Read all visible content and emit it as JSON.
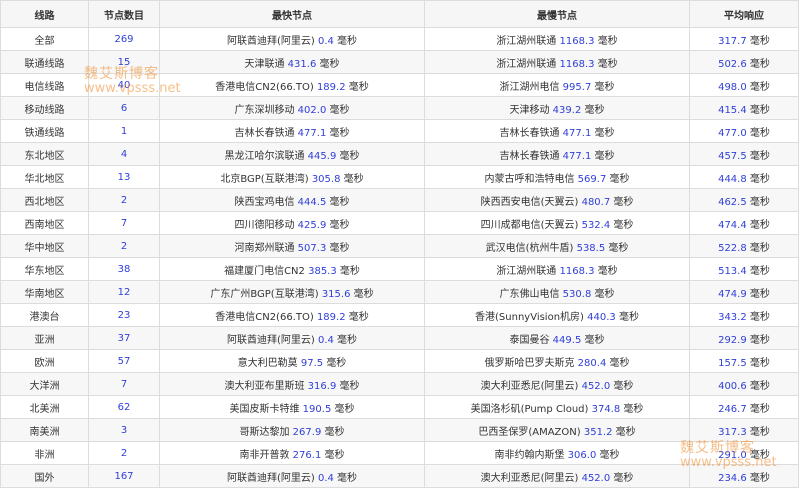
{
  "headers": {
    "route": "线路",
    "count": "节点数目",
    "fastest": "最快节点",
    "slowest": "最慢节点",
    "average": "平均响应"
  },
  "unit": "毫秒",
  "colors": {
    "number": "#2f3fd8",
    "watermark": "#f08a28"
  },
  "watermark": {
    "title": "魏艾斯博客",
    "url": "www.vpsss.net"
  },
  "rows": [
    {
      "route": "全部",
      "count": "269",
      "fast_name": "阿联酋迪拜(阿里云)",
      "fast_ms": "0.4",
      "slow_name": "浙江湖州联通",
      "slow_ms": "1168.3",
      "avg": "317.7"
    },
    {
      "route": "联通线路",
      "count": "15",
      "fast_name": "天津联通",
      "fast_ms": "431.6",
      "slow_name": "浙江湖州联通",
      "slow_ms": "1168.3",
      "avg": "502.6"
    },
    {
      "route": "电信线路",
      "count": "40",
      "fast_name": "香港电信CN2(66.TO)",
      "fast_ms": "189.2",
      "slow_name": "浙江湖州电信",
      "slow_ms": "995.7",
      "avg": "498.0"
    },
    {
      "route": "移动线路",
      "count": "6",
      "fast_name": "广东深圳移动",
      "fast_ms": "402.0",
      "slow_name": "天津移动",
      "slow_ms": "439.2",
      "avg": "415.4"
    },
    {
      "route": "铁通线路",
      "count": "1",
      "fast_name": "吉林长春铁通",
      "fast_ms": "477.1",
      "slow_name": "吉林长春铁通",
      "slow_ms": "477.1",
      "avg": "477.0"
    },
    {
      "route": "东北地区",
      "count": "4",
      "fast_name": "黑龙江哈尔滨联通",
      "fast_ms": "445.9",
      "slow_name": "吉林长春铁通",
      "slow_ms": "477.1",
      "avg": "457.5"
    },
    {
      "route": "华北地区",
      "count": "13",
      "fast_name": "北京BGP(互联港湾)",
      "fast_ms": "305.8",
      "slow_name": "内蒙古呼和浩特电信",
      "slow_ms": "569.7",
      "avg": "444.8"
    },
    {
      "route": "西北地区",
      "count": "2",
      "fast_name": "陕西宝鸡电信",
      "fast_ms": "444.5",
      "slow_name": "陕西西安电信(天翼云)",
      "slow_ms": "480.7",
      "avg": "462.5"
    },
    {
      "route": "西南地区",
      "count": "7",
      "fast_name": "四川德阳移动",
      "fast_ms": "425.9",
      "slow_name": "四川成都电信(天翼云)",
      "slow_ms": "532.4",
      "avg": "474.4"
    },
    {
      "route": "华中地区",
      "count": "2",
      "fast_name": "河南郑州联通",
      "fast_ms": "507.3",
      "slow_name": "武汉电信(杭州牛盾)",
      "slow_ms": "538.5",
      "avg": "522.8"
    },
    {
      "route": "华东地区",
      "count": "38",
      "fast_name": "福建厦门电信CN2",
      "fast_ms": "385.3",
      "slow_name": "浙江湖州联通",
      "slow_ms": "1168.3",
      "avg": "513.4"
    },
    {
      "route": "华南地区",
      "count": "12",
      "fast_name": "广东广州BGP(互联港湾)",
      "fast_ms": "315.6",
      "slow_name": "广东佛山电信",
      "slow_ms": "530.8",
      "avg": "474.9"
    },
    {
      "route": "港澳台",
      "count": "23",
      "fast_name": "香港电信CN2(66.TO)",
      "fast_ms": "189.2",
      "slow_name": "香港(SunnyVision机房)",
      "slow_ms": "440.3",
      "avg": "343.2"
    },
    {
      "route": "亚洲",
      "count": "37",
      "fast_name": "阿联酋迪拜(阿里云)",
      "fast_ms": "0.4",
      "slow_name": "泰国曼谷",
      "slow_ms": "449.5",
      "avg": "292.9"
    },
    {
      "route": "欧洲",
      "count": "57",
      "fast_name": "意大利巴勒莫",
      "fast_ms": "97.5",
      "slow_name": "俄罗斯哈巴罗夫斯克",
      "slow_ms": "280.4",
      "avg": "157.5"
    },
    {
      "route": "大洋洲",
      "count": "7",
      "fast_name": "澳大利亚布里斯班",
      "fast_ms": "316.9",
      "slow_name": "澳大利亚悉尼(阿里云)",
      "slow_ms": "452.0",
      "avg": "400.6"
    },
    {
      "route": "北美洲",
      "count": "62",
      "fast_name": "美国皮斯卡特维",
      "fast_ms": "190.5",
      "slow_name": "美国洛杉矶(Pump Cloud)",
      "slow_ms": "374.8",
      "avg": "246.7"
    },
    {
      "route": "南美洲",
      "count": "3",
      "fast_name": "哥斯达黎加",
      "fast_ms": "267.9",
      "slow_name": "巴西圣保罗(AMAZON)",
      "slow_ms": "351.2",
      "avg": "317.3"
    },
    {
      "route": "非洲",
      "count": "2",
      "fast_name": "南非开普敦",
      "fast_ms": "276.1",
      "slow_name": "南非约翰内斯堡",
      "slow_ms": "306.0",
      "avg": "291.0"
    },
    {
      "route": "国外",
      "count": "167",
      "fast_name": "阿联酋迪拜(阿里云)",
      "fast_ms": "0.4",
      "slow_name": "澳大利亚悉尼(阿里云)",
      "slow_ms": "452.0",
      "avg": "234.6"
    }
  ]
}
